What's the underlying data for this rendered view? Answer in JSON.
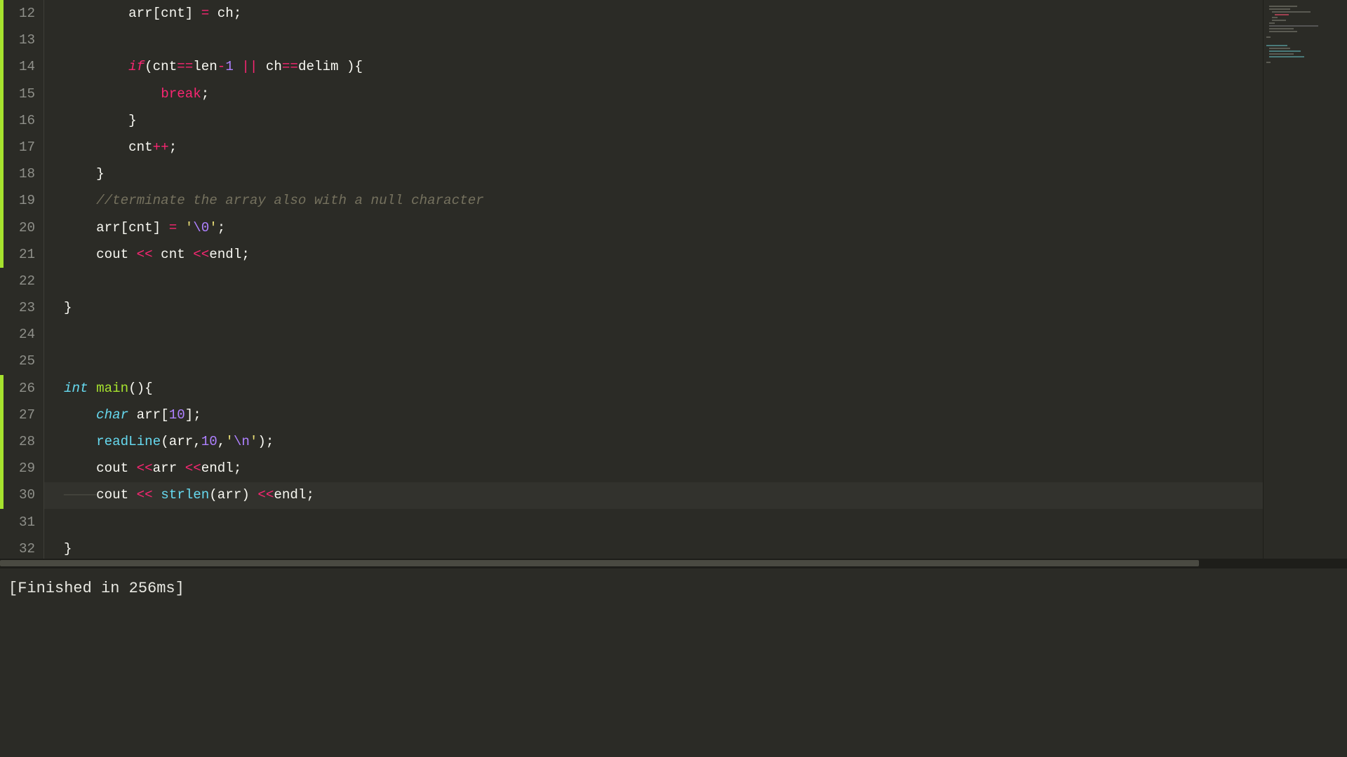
{
  "gutter": {
    "start": 12,
    "end": 32,
    "modified_ranges": [
      [
        12,
        21
      ],
      [
        26,
        30
      ]
    ],
    "active_line": 30
  },
  "code": {
    "lines": [
      {
        "n": 12,
        "indent": 8,
        "segs": [
          [
            "pln",
            "arr[cnt] "
          ],
          [
            "op",
            "="
          ],
          [
            "pln",
            " ch;"
          ]
        ]
      },
      {
        "n": 13,
        "indent": 0,
        "segs": []
      },
      {
        "n": 14,
        "indent": 8,
        "segs": [
          [
            "kw",
            "if"
          ],
          [
            "pln",
            "(cnt"
          ],
          [
            "op",
            "=="
          ],
          [
            "pln",
            "len"
          ],
          [
            "op",
            "-"
          ],
          [
            "num",
            "1"
          ],
          [
            "pln",
            " "
          ],
          [
            "op",
            "||"
          ],
          [
            "pln",
            " ch"
          ],
          [
            "op",
            "=="
          ],
          [
            "pln",
            "delim ){"
          ]
        ]
      },
      {
        "n": 15,
        "indent": 12,
        "segs": [
          [
            "kw2",
            "break"
          ],
          [
            "pln",
            ";"
          ]
        ]
      },
      {
        "n": 16,
        "indent": 8,
        "segs": [
          [
            "pln",
            "}"
          ]
        ]
      },
      {
        "n": 17,
        "indent": 8,
        "segs": [
          [
            "pln",
            "cnt"
          ],
          [
            "op",
            "++"
          ],
          [
            "pln",
            ";"
          ]
        ]
      },
      {
        "n": 18,
        "indent": 4,
        "segs": [
          [
            "pln",
            "}"
          ]
        ]
      },
      {
        "n": 19,
        "indent": 4,
        "segs": [
          [
            "cmt",
            "//terminate the array also with a null character"
          ]
        ]
      },
      {
        "n": 20,
        "indent": 4,
        "segs": [
          [
            "pln",
            "arr[cnt] "
          ],
          [
            "op",
            "="
          ],
          [
            "pln",
            " "
          ],
          [
            "str",
            "'"
          ],
          [
            "esc",
            "\\0"
          ],
          [
            "str",
            "'"
          ],
          [
            "pln",
            ";"
          ]
        ]
      },
      {
        "n": 21,
        "indent": 4,
        "segs": [
          [
            "pln",
            "cout "
          ],
          [
            "op",
            "<<"
          ],
          [
            "pln",
            " cnt "
          ],
          [
            "op",
            "<<"
          ],
          [
            "pln",
            "endl;"
          ]
        ]
      },
      {
        "n": 22,
        "indent": 0,
        "segs": []
      },
      {
        "n": 23,
        "indent": 0,
        "segs": [
          [
            "pln",
            "}"
          ]
        ]
      },
      {
        "n": 24,
        "indent": 0,
        "segs": []
      },
      {
        "n": 25,
        "indent": 0,
        "segs": []
      },
      {
        "n": 26,
        "indent": 0,
        "segs": [
          [
            "type",
            "int"
          ],
          [
            "pln",
            " "
          ],
          [
            "fndef",
            "main"
          ],
          [
            "pln",
            "(){"
          ]
        ]
      },
      {
        "n": 27,
        "indent": 4,
        "segs": [
          [
            "type",
            "char"
          ],
          [
            "pln",
            " arr["
          ],
          [
            "num",
            "10"
          ],
          [
            "pln",
            "];"
          ]
        ]
      },
      {
        "n": 28,
        "indent": 4,
        "segs": [
          [
            "fn",
            "readLine"
          ],
          [
            "pln",
            "(arr,"
          ],
          [
            "num",
            "10"
          ],
          [
            "pln",
            ","
          ],
          [
            "str",
            "'"
          ],
          [
            "esc",
            "\\n"
          ],
          [
            "str",
            "'"
          ],
          [
            "pln",
            ");"
          ]
        ]
      },
      {
        "n": 29,
        "indent": 4,
        "segs": [
          [
            "pln",
            "cout "
          ],
          [
            "op",
            "<<"
          ],
          [
            "pln",
            "arr "
          ],
          [
            "op",
            "<<"
          ],
          [
            "pln",
            "endl;"
          ]
        ]
      },
      {
        "n": 30,
        "indent": 4,
        "ws": true,
        "segs": [
          [
            "pln",
            "cout "
          ],
          [
            "op",
            "<<"
          ],
          [
            "pln",
            " "
          ],
          [
            "fn",
            "strlen"
          ],
          [
            "pln",
            "(arr) "
          ],
          [
            "op",
            "<<"
          ],
          [
            "pln",
            "endl;"
          ]
        ]
      },
      {
        "n": 31,
        "indent": 0,
        "segs": []
      },
      {
        "n": 32,
        "indent": 0,
        "segs": [
          [
            "pln",
            "}"
          ]
        ]
      }
    ]
  },
  "console": {
    "output": "[Finished in 256ms]"
  },
  "colors": {
    "bg": "#2b2b26",
    "keyword": "#f92672",
    "type": "#66d9ef",
    "string": "#e6db74",
    "number": "#ae81ff",
    "comment": "#75715e",
    "function": "#a6e22e"
  }
}
